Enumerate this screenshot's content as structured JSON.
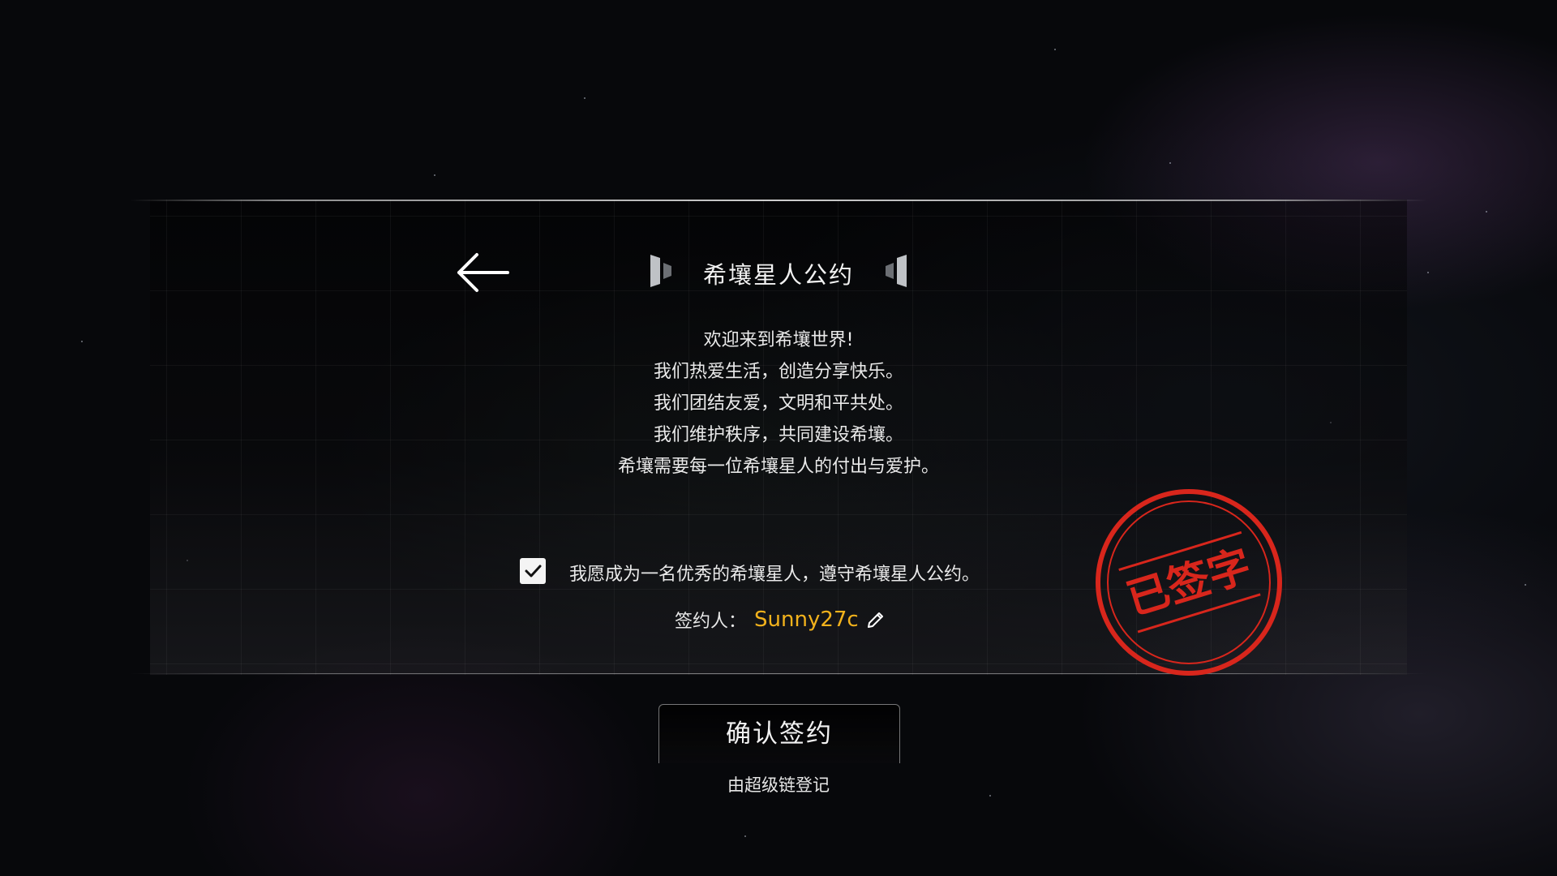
{
  "header": {
    "title": "希壤星人公约"
  },
  "pledge": {
    "lines": [
      "欢迎来到希壤世界!",
      "我们热爱生活，创造分享快乐。",
      "我们团结友爱，文明和平共处。",
      "我们维护秩序，共同建设希壤。",
      "希壤需要每一位希壤星人的付出与爱护。"
    ]
  },
  "agreement": {
    "checked": true,
    "text": "我愿成为一名优秀的希壤星人，遵守希壤星人公约。"
  },
  "signer": {
    "label": "签约人：",
    "name": "Sunny27c"
  },
  "stamp": {
    "text": "已签字",
    "color": "#d8261c"
  },
  "actions": {
    "confirm_label": "确认签约"
  },
  "footer": {
    "note": "由超级链登记"
  },
  "colors": {
    "accent_name": "#f3b21c",
    "stamp_red": "#d8261c"
  },
  "icons": [
    "back-arrow-icon",
    "checkmark-icon",
    "edit-pencil-icon"
  ]
}
